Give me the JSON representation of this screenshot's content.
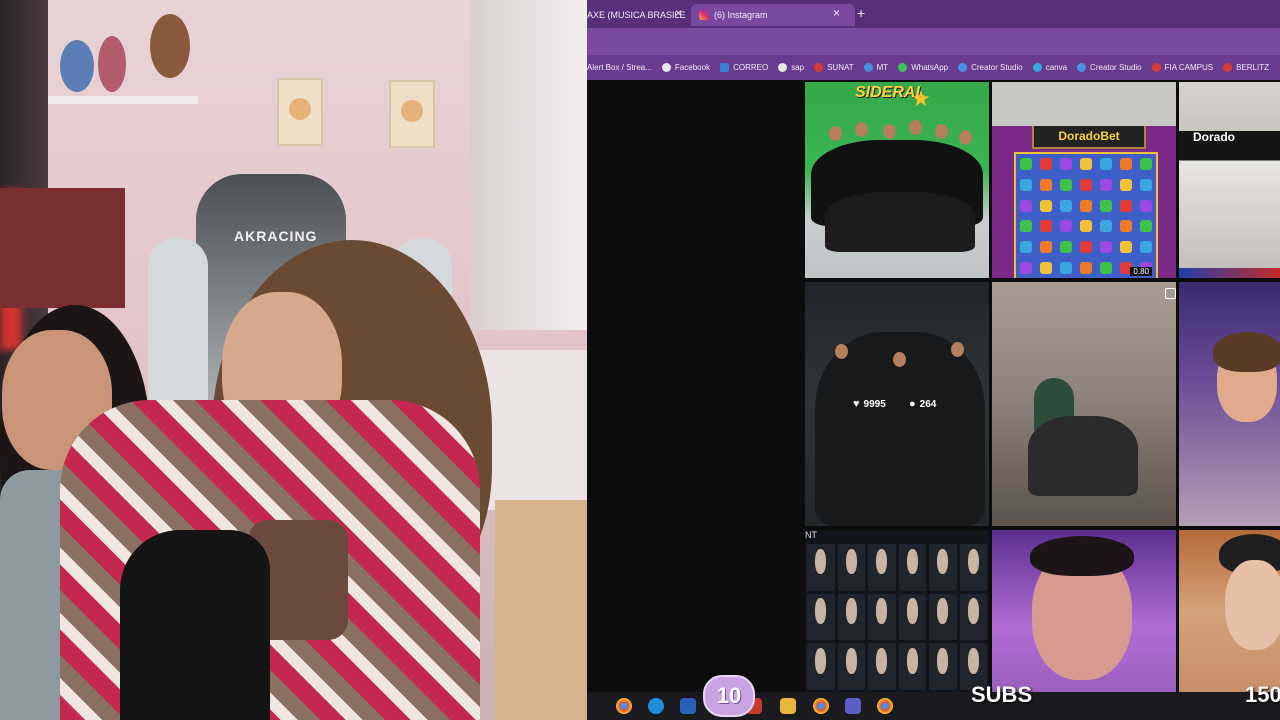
{
  "browser": {
    "tabs": [
      {
        "label": "AXE (MUSICA BRASILE",
        "icon": "music-tab-icon",
        "active": false
      },
      {
        "label": "(6) Instagram",
        "icon": "instagram-icon",
        "active": true
      }
    ],
    "new_tab": "+",
    "close_glyph": "×",
    "bookmarks": [
      {
        "label": "Alert Box / Strea...",
        "icon": "streamlabs-icon",
        "color": "#a86bd6"
      },
      {
        "label": "Facebook",
        "icon": "facebook-icon",
        "color": "#e8e8e8"
      },
      {
        "label": "CORREO",
        "icon": "outlook-icon",
        "color": "#3b82d6"
      },
      {
        "label": "sap",
        "icon": "sap-icon",
        "color": "#e8e8e8"
      },
      {
        "label": "SUNAT",
        "icon": "sunat-icon",
        "color": "#d83a3a"
      },
      {
        "label": "MT",
        "icon": "mt-icon",
        "color": "#4a90e2"
      },
      {
        "label": "WhatsApp",
        "icon": "whatsapp-icon",
        "color": "#3fc35c"
      },
      {
        "label": "Creator Studio",
        "icon": "creator-studio-icon",
        "color": "#4a90e2"
      },
      {
        "label": "canva",
        "icon": "canva-icon",
        "color": "#3aa7e0"
      },
      {
        "label": "Creator Studio",
        "icon": "creator-studio-icon",
        "color": "#4a90e2"
      },
      {
        "label": "FIA CAMPUS",
        "icon": "fia-icon",
        "color": "#d83a3a"
      },
      {
        "label": "BERLITZ",
        "icon": "berlitz-icon",
        "color": "#d83a3a"
      }
    ]
  },
  "feed": {
    "group_banner": "SIDERAL",
    "slot_title": "DoradoBet",
    "slot_value": "0.80",
    "dorado_label": "Dorado",
    "likes": "9995",
    "comments": "264",
    "team_header": "NT"
  },
  "webcam": {
    "chair_brand": "AKRACING"
  },
  "overlay": {
    "sub_count": "10",
    "sub_label": "SUBS",
    "sub_goal": "150"
  }
}
